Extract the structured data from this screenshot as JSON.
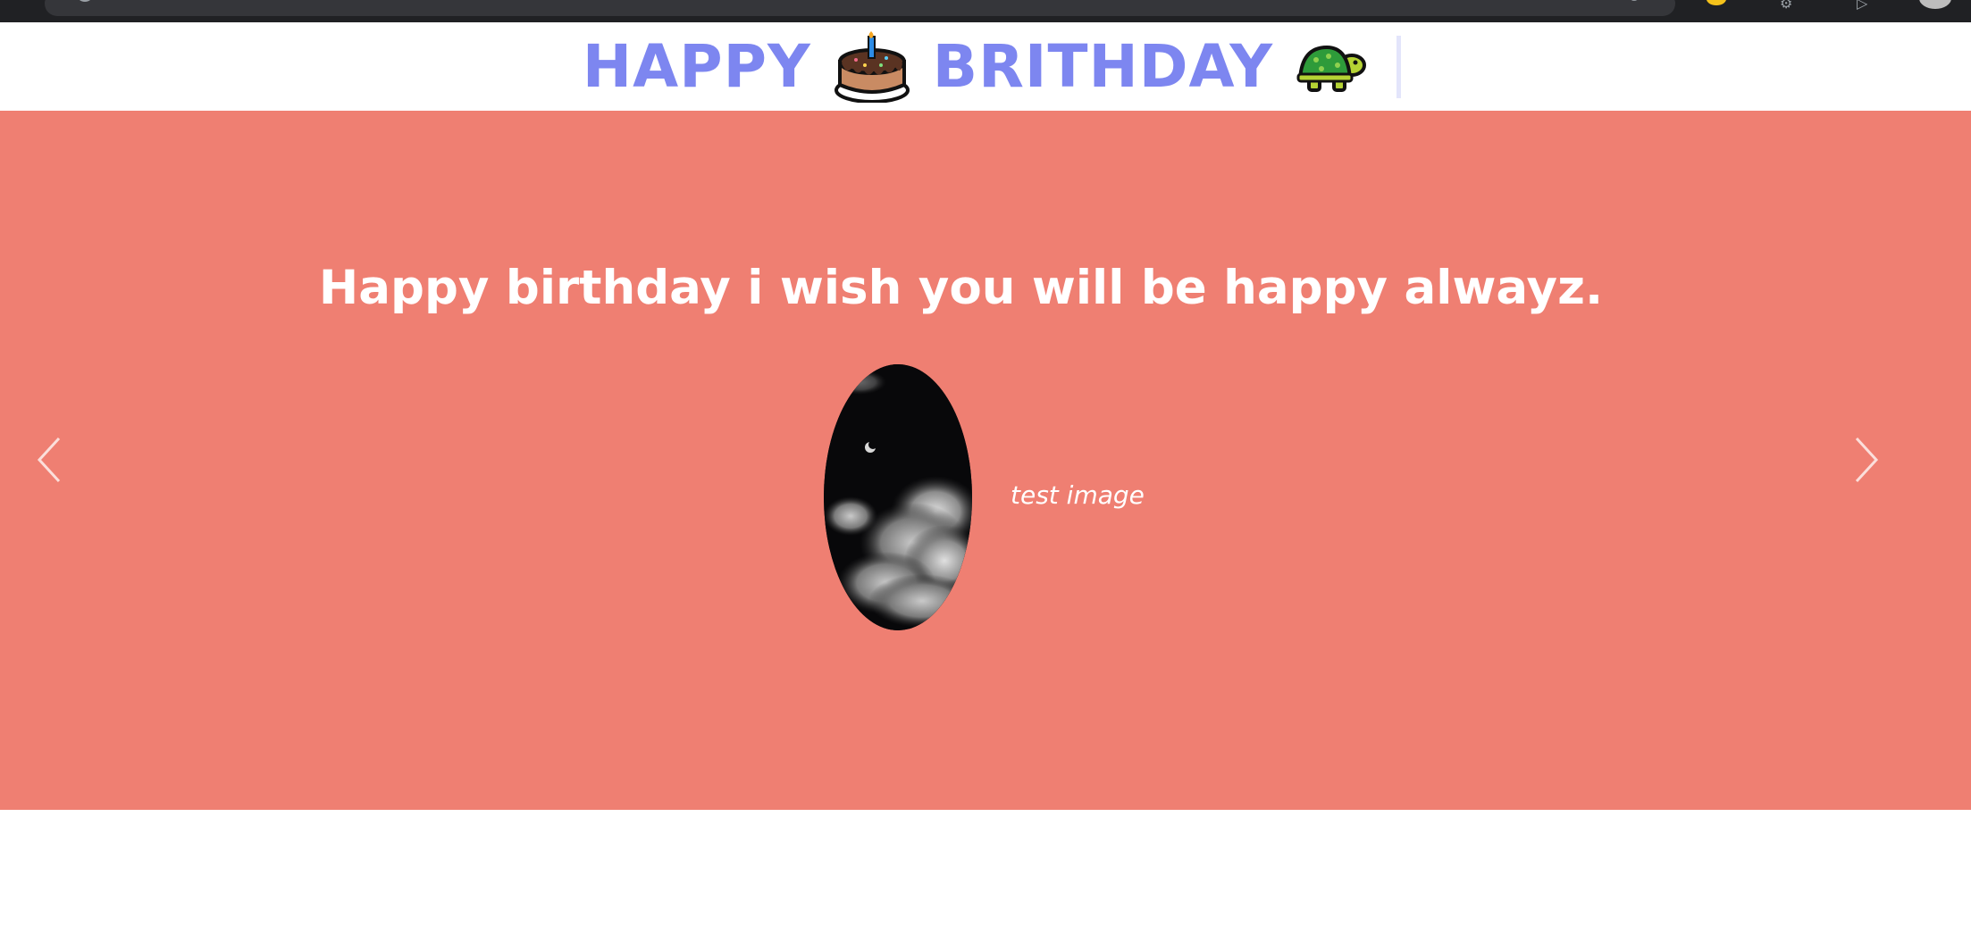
{
  "header": {
    "title_part1": "HAPPY",
    "cake_emoji": "🎂",
    "title_part2": "BRITHDAY",
    "turtle_emoji": "🐢"
  },
  "carousel": {
    "slide_text": "Happy birthday i wish you will be happy alwayz.",
    "image_caption": "test image",
    "image_alt": "night sky with clouds and moon",
    "background_color": "#ef7f72"
  },
  "icons": {
    "prev": "chevron-left-icon",
    "next": "chevron-right-icon"
  },
  "colors": {
    "title": "#7d86f0",
    "carousel_bg": "#ef7f72",
    "text": "#ffffff"
  }
}
